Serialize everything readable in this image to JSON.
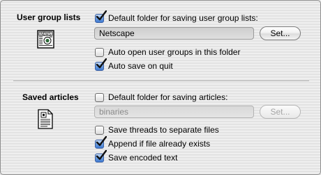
{
  "user_group_lists": {
    "title": "User group lists",
    "icon": "newspaper-icon",
    "default_folder": {
      "label": "Default folder for saving user group lists:",
      "checked": true
    },
    "folder_field": {
      "value": "Netscape",
      "enabled": true
    },
    "set_button": {
      "label": "Set...",
      "enabled": true
    },
    "auto_open": {
      "label": "Auto open user groups in this folder",
      "checked": false
    },
    "auto_save": {
      "label": "Auto save on quit",
      "checked": true
    }
  },
  "saved_articles": {
    "title": "Saved articles",
    "icon": "document-icon",
    "default_folder": {
      "label": "Default folder for saving articles:",
      "checked": false
    },
    "folder_field": {
      "value": "binaries",
      "enabled": false
    },
    "set_button": {
      "label": "Set...",
      "enabled": false
    },
    "save_threads": {
      "label": "Save threads to separate files",
      "checked": false
    },
    "append": {
      "label": "Append if file already exists",
      "checked": true
    },
    "save_encoded": {
      "label": "Save encoded text",
      "checked": true
    }
  },
  "colors": {
    "checkbox_accent": "#3f79d0",
    "disabled_text": "#8a8a8a"
  }
}
